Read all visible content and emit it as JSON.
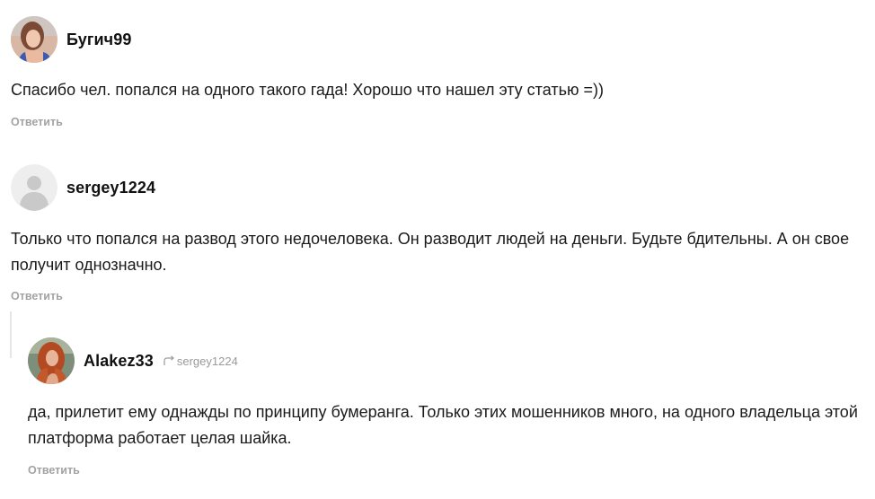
{
  "comments": [
    {
      "username": "Бугич99",
      "text": "Спасибо чел. попался на одного такого гада! Хорошо что нашел эту статью =))",
      "reply_label": "Ответить"
    },
    {
      "username": "sergey1224",
      "text": "Только что попался на развод этого недочеловека. Он разводит людей на деньги. Будьте бдительны. А он свое получит однозначно.",
      "reply_label": "Ответить",
      "replies": [
        {
          "username": "Alakez33",
          "reply_to": "sergey1224",
          "text": "да, прилетит ему однажды по принципу бумеранга. Только этих мошенников много, на одного владельца этой платформа работает целая шайка.",
          "reply_label": "Ответить"
        }
      ]
    }
  ],
  "icons": {
    "reply_arrow": "reply-arrow-icon",
    "default_avatar": "user-silhouette-icon"
  },
  "colors": {
    "text": "#1a1a1a",
    "muted": "#a3a3a3",
    "thread_line": "#e6e6e6"
  }
}
